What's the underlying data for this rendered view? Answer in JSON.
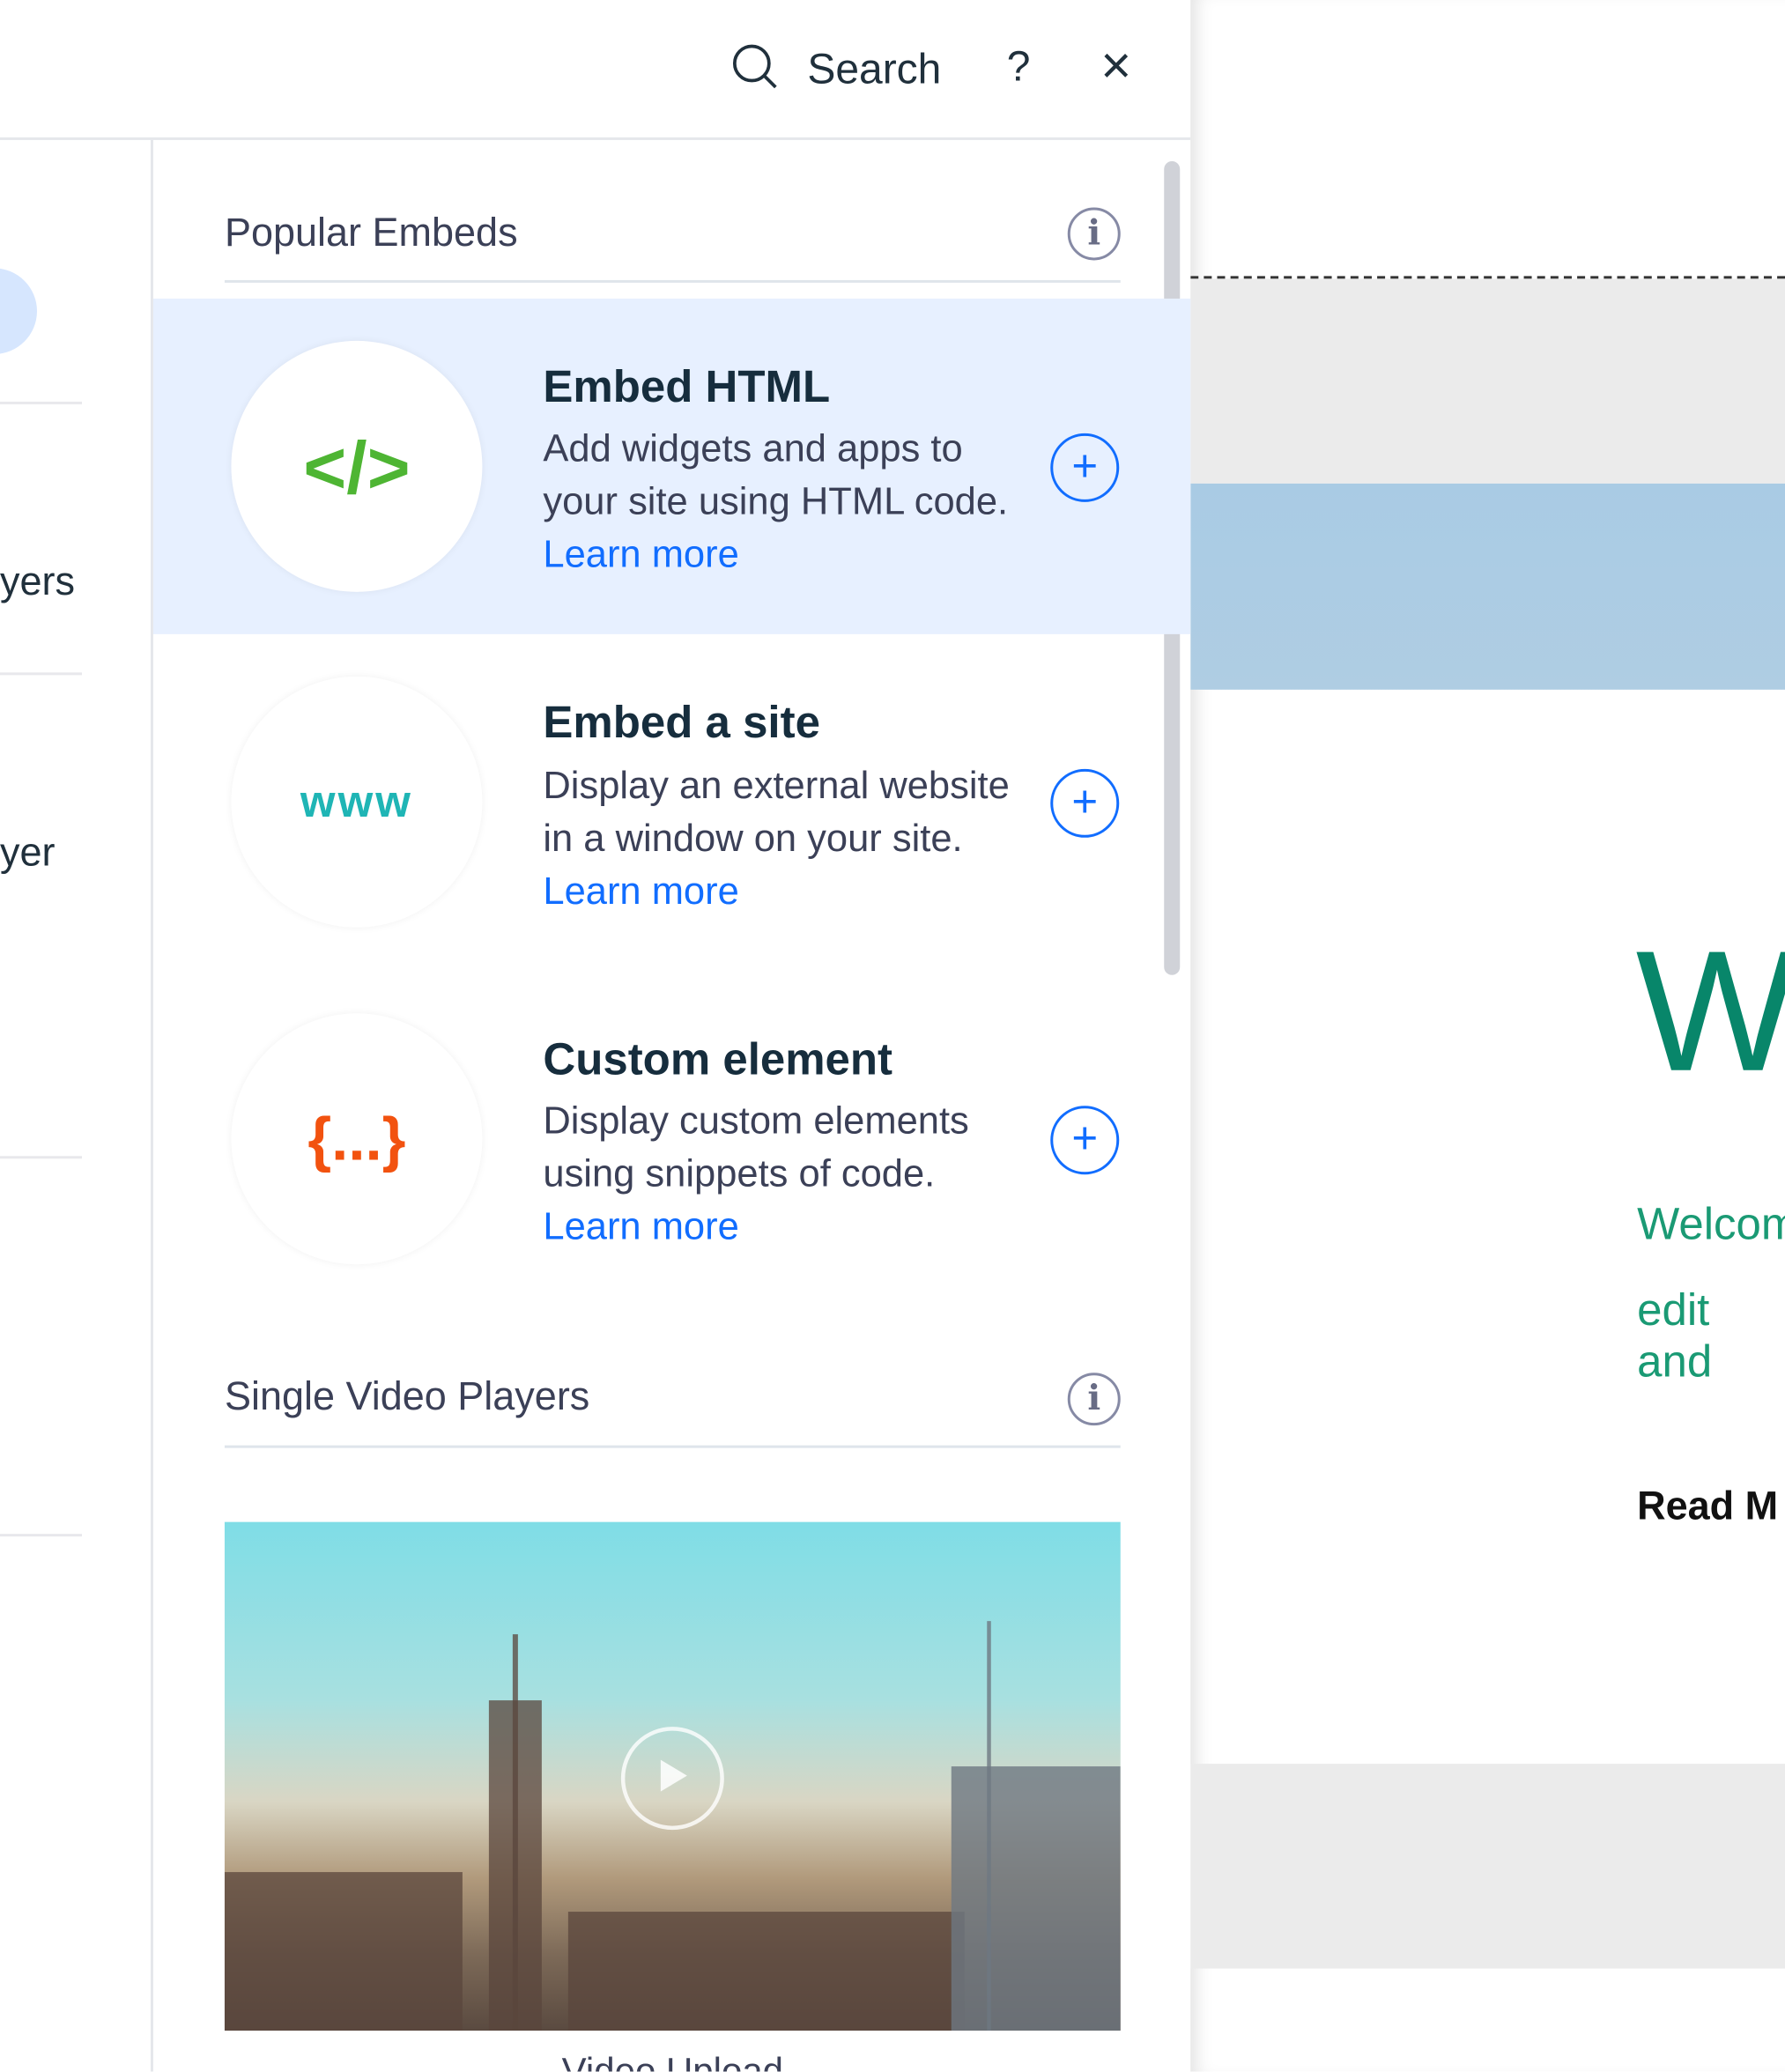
{
  "topbar": {
    "search_label": "Search",
    "help_label": "?",
    "close_label": "×"
  },
  "left_column": {
    "items": [
      "yers",
      "yer"
    ]
  },
  "sections": [
    {
      "title": "Popular Embeds",
      "items": [
        {
          "title": "Embed HTML",
          "description": "Add widgets and apps to your site using HTML code.",
          "link": "Learn more",
          "icon_text": "</>",
          "icon_color": "#4eb533",
          "highlighted": true
        },
        {
          "title": "Embed a site",
          "description": "Display an external website in a window on your site.",
          "link": "Learn more",
          "icon_text": "www",
          "icon_color": "#1fb5b5",
          "highlighted": false
        },
        {
          "title": "Custom element",
          "description": "Display custom elements using snippets of code.",
          "link": "Learn more",
          "icon_text": "{...}",
          "icon_color": "#f2520f",
          "highlighted": false
        }
      ]
    },
    {
      "title": "Single Video Players",
      "items": [
        {
          "title": "Video Upload"
        }
      ]
    }
  ],
  "canvas": {
    "heading": "W",
    "welcome_line1": "Welcom",
    "welcome_line2": "edit and",
    "read_more": "Read M"
  },
  "colors": {
    "accent": "#116dff",
    "highlight": "#e7f0ff",
    "site_green": "#08866a"
  }
}
